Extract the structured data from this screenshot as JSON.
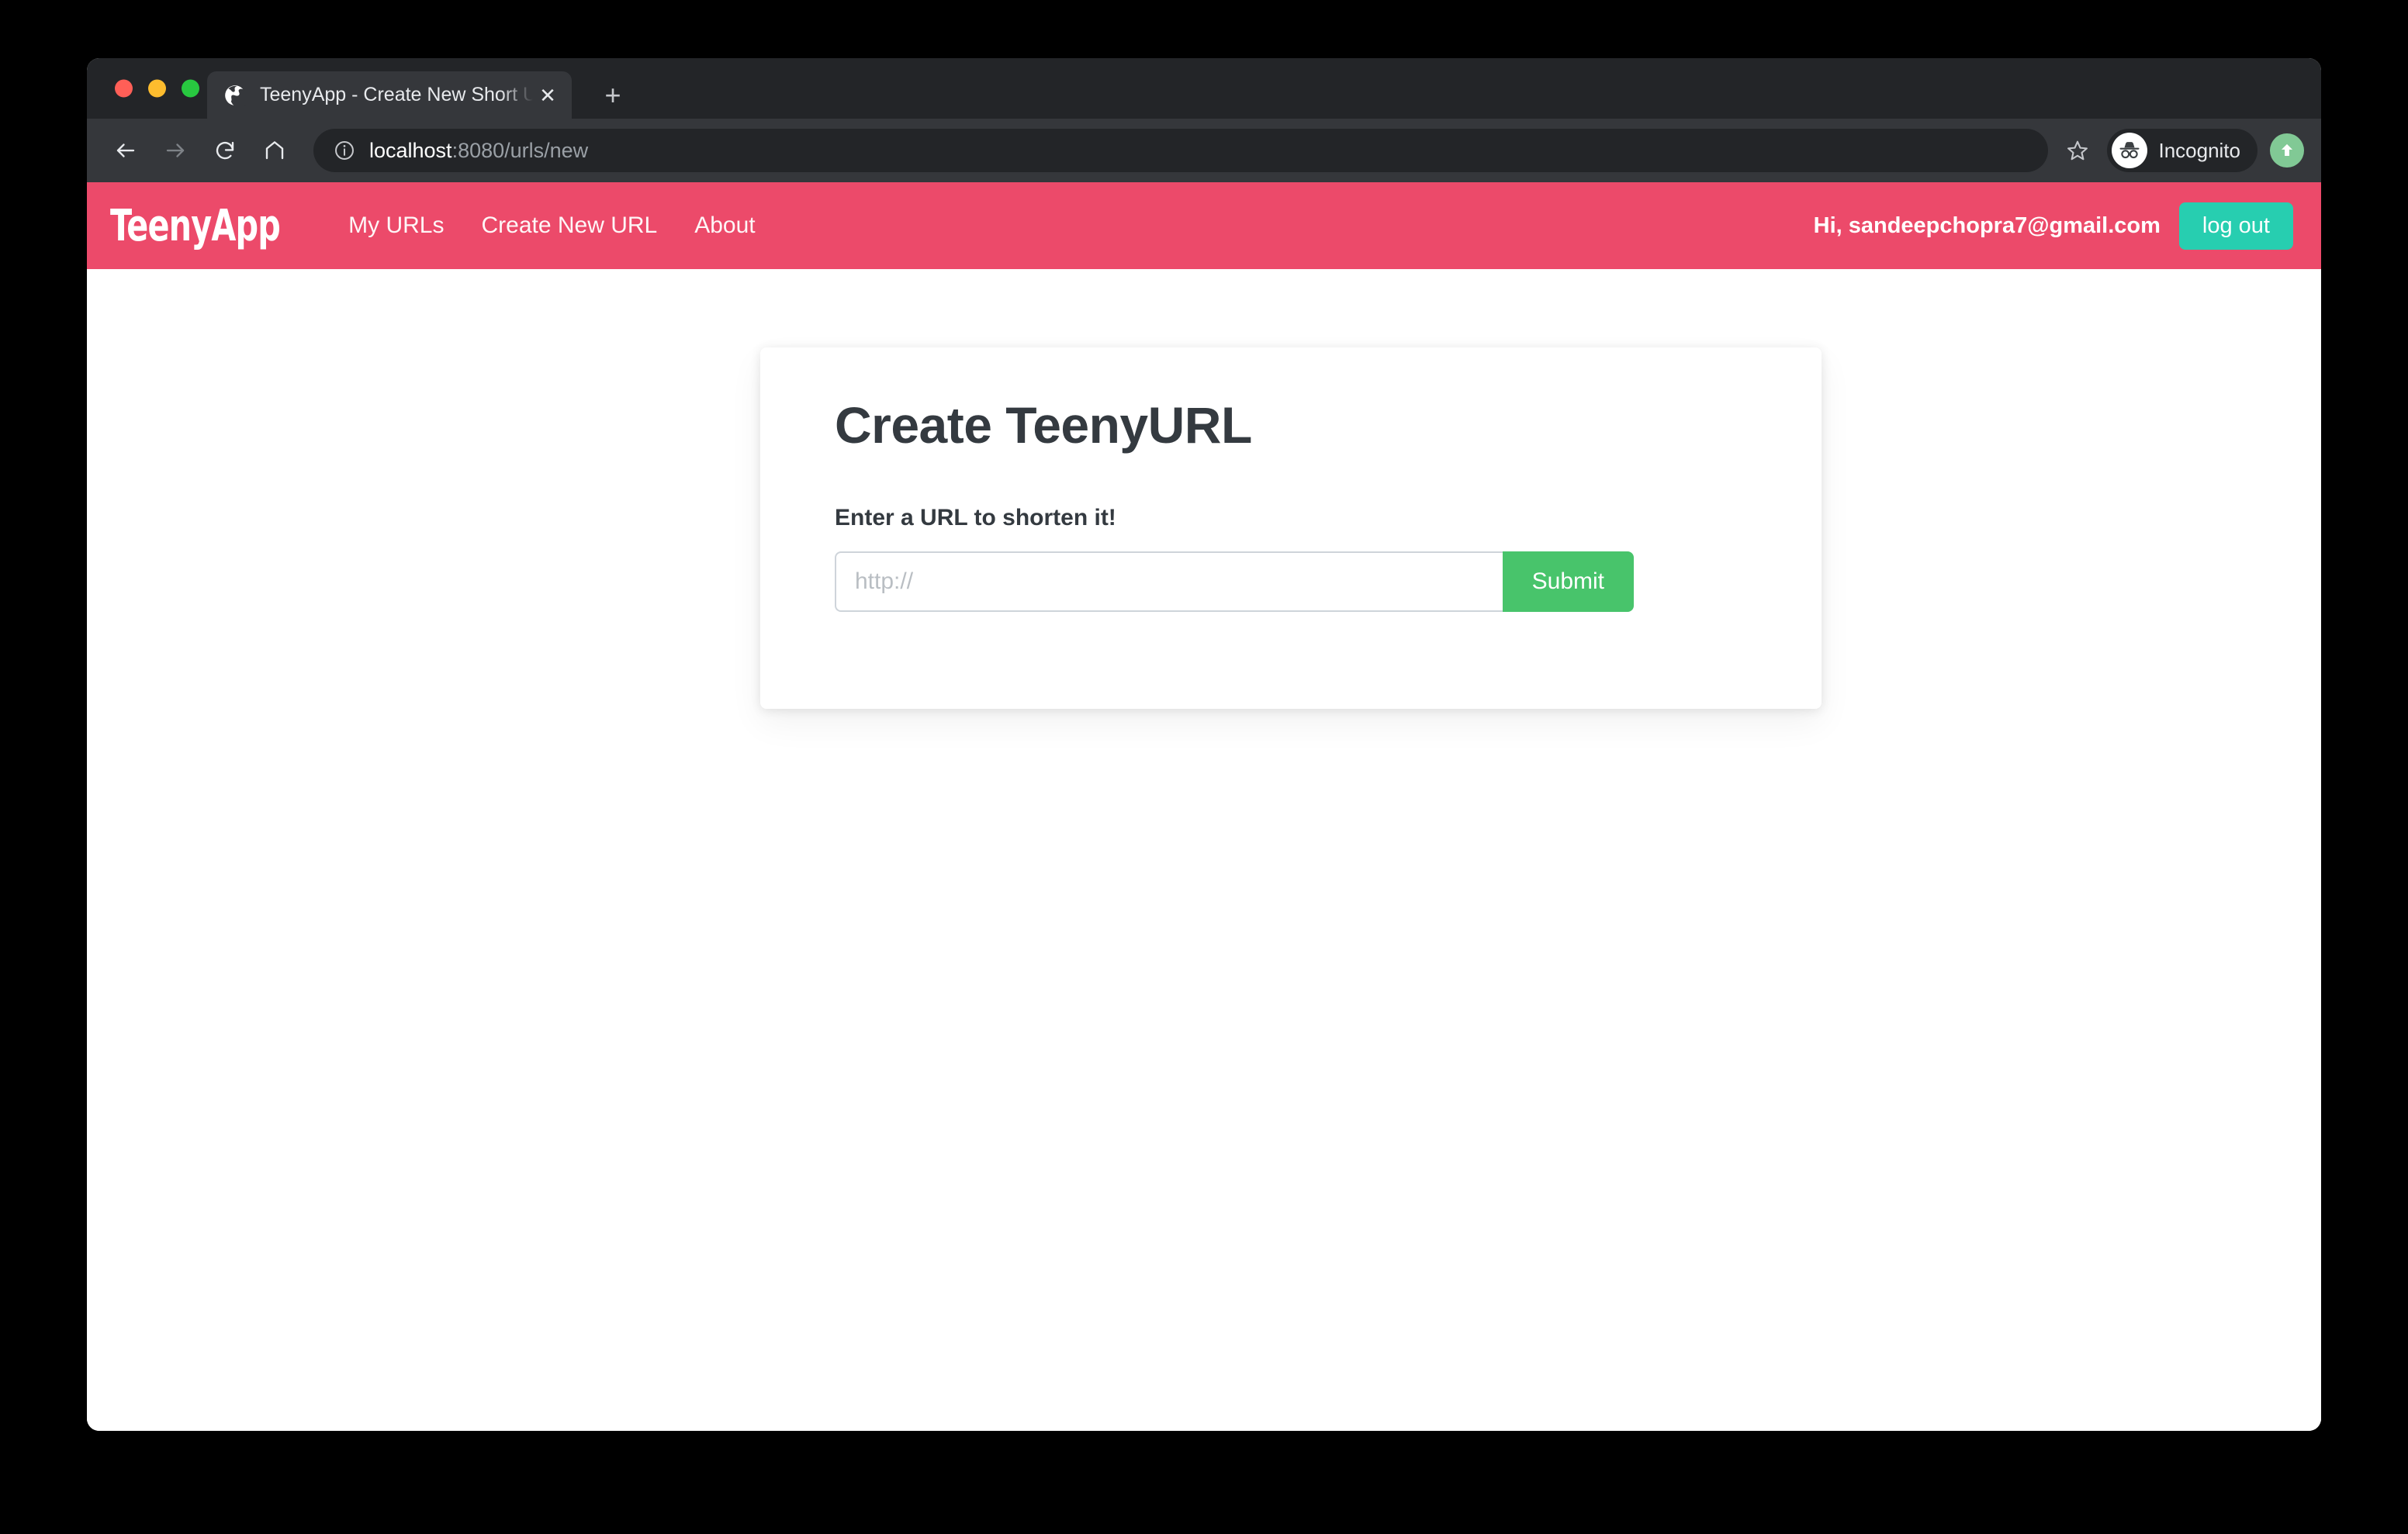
{
  "browser": {
    "tab": {
      "title": "TeenyApp - Create New Short U",
      "favicon": "globe-icon",
      "close_label": "✕"
    },
    "new_tab_label": "+",
    "toolbar": {
      "back_icon": "back-arrow-icon",
      "forward_icon": "forward-arrow-icon",
      "reload_icon": "reload-icon",
      "home_icon": "home-icon",
      "site_info_icon": "info-icon",
      "url_host": "localhost",
      "url_path": ":8080/urls/new",
      "bookmark_icon": "star-icon",
      "profile_label": "Incognito",
      "profile_icon": "incognito-icon",
      "update_icon": "update-arrow-icon"
    },
    "traffic_lights": {
      "close": "#ff5f57",
      "minimize": "#fdbc2e",
      "zoom": "#28c840"
    }
  },
  "navbar": {
    "brand": "TeenyApp",
    "links": [
      {
        "label": "My URLs"
      },
      {
        "label": "Create New URL"
      },
      {
        "label": "About"
      }
    ],
    "greeting": "Hi, sandeepchopra7@gmail.com",
    "logout_label": "log out",
    "background_color": "#ec4a6a",
    "logout_color": "#27ceb0"
  },
  "card": {
    "title": "Create TeenyURL",
    "form_label": "Enter a URL to shorten it!",
    "input_placeholder": "http://",
    "input_value": "",
    "submit_label": "Submit",
    "submit_color": "#48c46b"
  }
}
